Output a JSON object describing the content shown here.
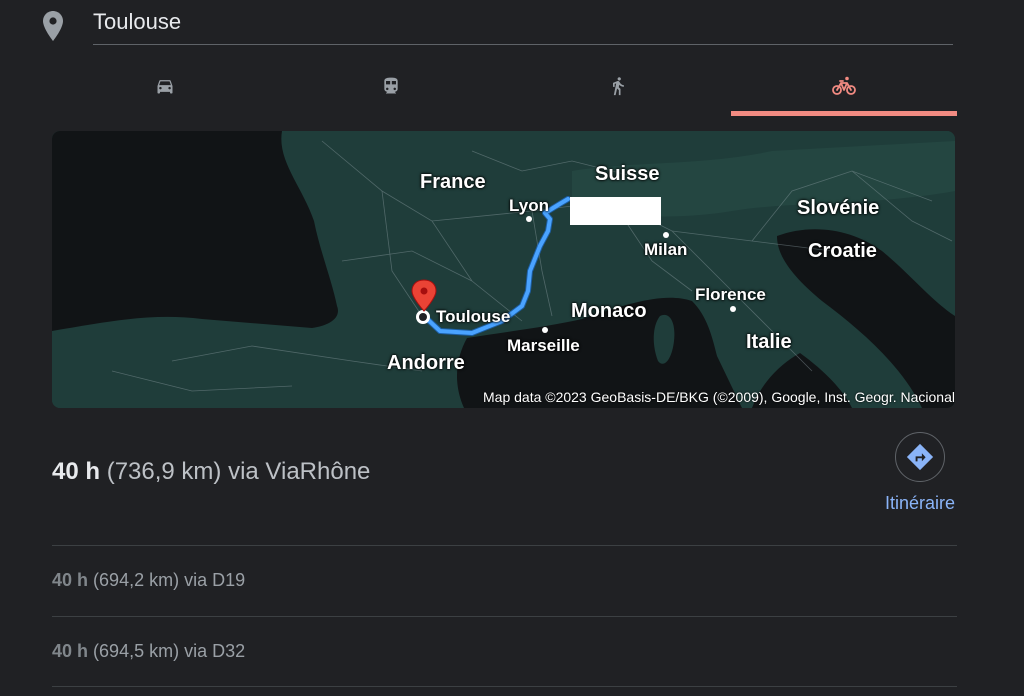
{
  "destination": {
    "value": "Toulouse"
  },
  "tabs": [
    {
      "name": "car-icon",
      "active": false
    },
    {
      "name": "train-icon",
      "active": false
    },
    {
      "name": "walk-icon",
      "active": false
    },
    {
      "name": "bicycle-icon",
      "active": true
    }
  ],
  "map": {
    "labels": {
      "france": "France",
      "suisse": "Suisse",
      "lyon": "Lyon",
      "slovenie": "Slovénie",
      "croatie": "Croatie",
      "milan": "Milan",
      "florence": "Florence",
      "toulouse": "Toulouse",
      "monaco": "Monaco",
      "marseille": "Marseille",
      "italie": "Italie",
      "andorre": "Andorre"
    },
    "attribution": "Map data ©2023 GeoBasis-DE/BKG (©2009), Google, Inst. Geogr. Nacional",
    "route_color": "#4aa3ff",
    "marker_color": "#ea4335"
  },
  "routes": {
    "main": {
      "duration": "40 h",
      "detail": "(736,9 km) via ViaRhône"
    },
    "directions_label": "Itinéraire",
    "alternatives": [
      {
        "duration": "40 h",
        "detail": "(694,2 km) via D19"
      },
      {
        "duration": "40 h",
        "detail": "(694,5 km) via D32"
      }
    ]
  },
  "colors": {
    "accent": "#f28b82",
    "link": "#8ab4f8",
    "background": "#202124"
  }
}
